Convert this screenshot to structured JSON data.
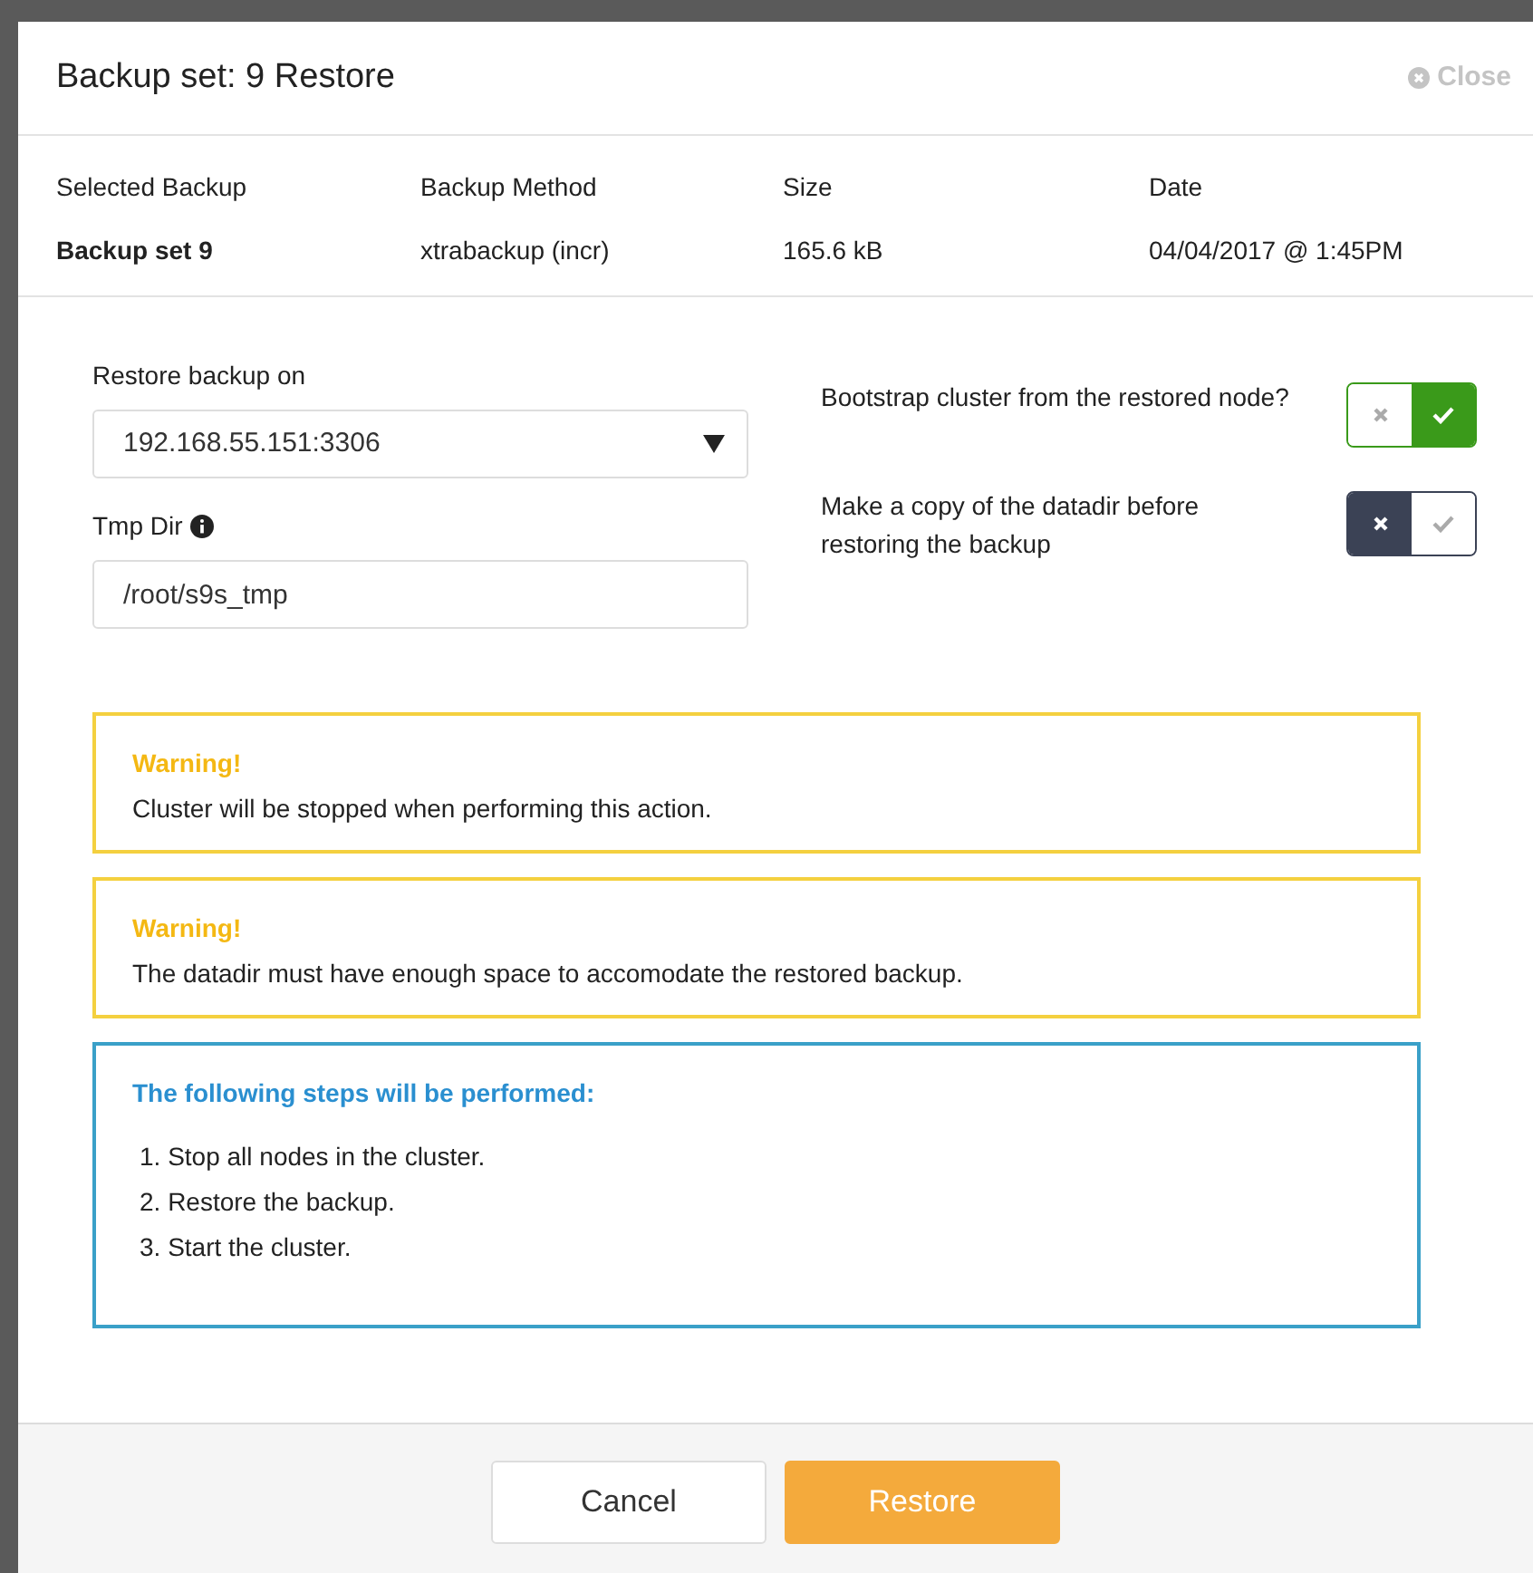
{
  "dialog": {
    "title": "Backup set: 9 Restore",
    "close_label": "Close"
  },
  "summary": {
    "columns": [
      "Selected Backup",
      "Backup Method",
      "Size",
      "Date"
    ],
    "row": [
      "Backup set 9",
      "xtrabackup (incr)",
      "165.6 kB",
      "04/04/2017 @ 1:45PM"
    ]
  },
  "form": {
    "restore_on": {
      "label": "Restore backup on",
      "value": "192.168.55.151:3306"
    },
    "tmp_dir": {
      "label": "Tmp Dir",
      "value": "/root/s9s_tmp"
    },
    "toggles": [
      {
        "label": "Bootstrap cluster from the restored node?",
        "on": true
      },
      {
        "label": "Make a copy of the datadir before restoring the backup",
        "on": false
      }
    ]
  },
  "alerts": [
    {
      "kind": "warning",
      "title": "Warning!",
      "text": "Cluster will be stopped when performing this action."
    },
    {
      "kind": "warning",
      "title": "Warning!",
      "text": "The datadir must have enough space to accomodate the restored backup."
    },
    {
      "kind": "info",
      "title": "The following steps will be performed:",
      "steps": [
        "1. Stop all nodes in the cluster.",
        "2. Restore the backup.",
        "3. Start the cluster."
      ]
    }
  ],
  "buttons": [
    {
      "kind": "secondary",
      "label": "Cancel"
    },
    {
      "kind": "primary",
      "label": "Restore"
    }
  ]
}
